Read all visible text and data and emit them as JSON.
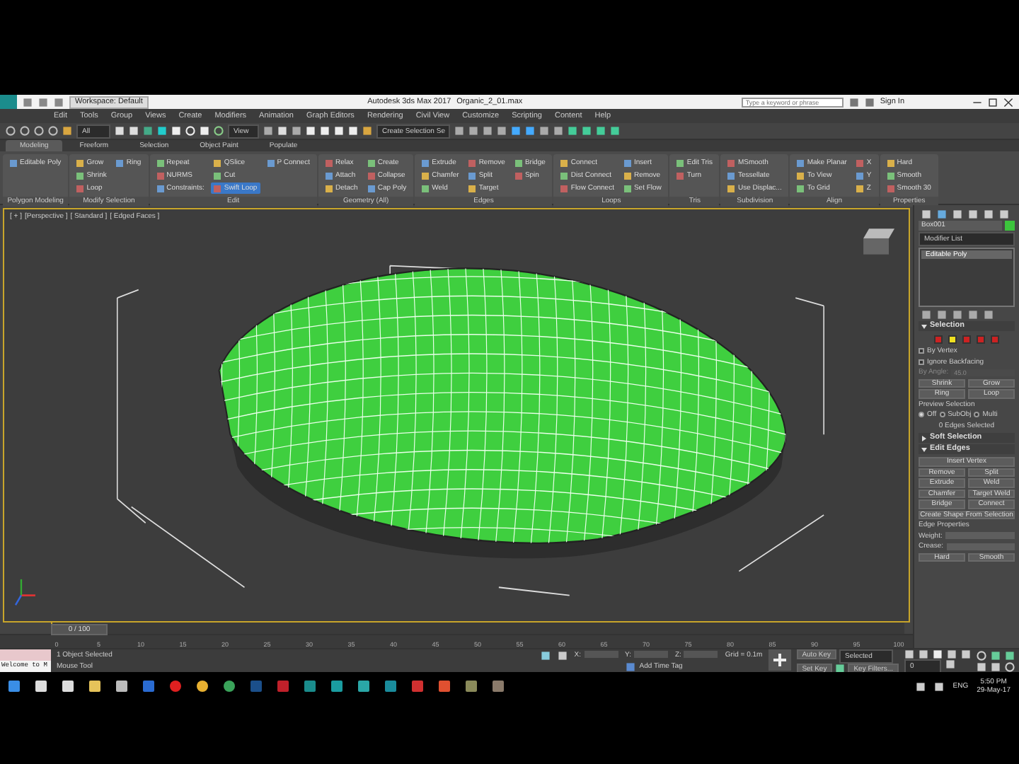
{
  "title_bar": {
    "workspace": "Workspace: Default",
    "title": "Autodesk 3ds Max 2017",
    "file": "Organic_2_01.max",
    "search": {
      "placeholder": "Type a keyword or phrase"
    },
    "sign_in": "Sign In"
  },
  "menu": [
    "Edit",
    "Tools",
    "Group",
    "Views",
    "Create",
    "Modifiers",
    "Animation",
    "Graph Editors",
    "Rendering",
    "Civil View",
    "Customize",
    "Scripting",
    "Content",
    "Help"
  ],
  "toolbar": {
    "filter": "All",
    "ref_coord": "View",
    "selection_set": "Create Selection Se"
  },
  "ribbon_tabs": [
    {
      "label": "Modeling",
      "selected": true
    },
    {
      "label": "Freeform",
      "selected": false
    },
    {
      "label": "Selection",
      "selected": false
    },
    {
      "label": "Object Paint",
      "selected": false
    },
    {
      "label": "Populate",
      "selected": false
    }
  ],
  "ribbon_panels": [
    {
      "title": "Polygon Modeling",
      "items": [
        {
          "label": "Editable Poly",
          "selected": false
        }
      ]
    },
    {
      "title": "Modify Selection",
      "items": [
        {
          "label": "Grow",
          "selected": false
        },
        {
          "label": "Shrink",
          "selected": false
        },
        {
          "label": "Loop",
          "selected": false
        },
        {
          "label": "Ring",
          "selected": false
        }
      ]
    },
    {
      "title": "Edit",
      "items": [
        {
          "label": "Repeat",
          "selected": false
        },
        {
          "label": "NURMS",
          "selected": false
        },
        {
          "label": "Constraints:",
          "selected": false
        },
        {
          "label": "QSlice",
          "selected": false
        },
        {
          "label": "Cut",
          "selected": false
        },
        {
          "label": "Swift Loop",
          "selected": true
        },
        {
          "label": "P Connect",
          "selected": false
        }
      ]
    },
    {
      "title": "Geometry (All)",
      "items": [
        {
          "label": "Relax",
          "selected": false
        },
        {
          "label": "Attach",
          "selected": false
        },
        {
          "label": "Detach",
          "selected": false
        },
        {
          "label": "Create",
          "selected": false
        },
        {
          "label": "Collapse",
          "selected": false
        },
        {
          "label": "Cap Poly",
          "selected": false
        }
      ]
    },
    {
      "title": "Edges",
      "items": [
        {
          "label": "Extrude",
          "selected": false
        },
        {
          "label": "Chamfer",
          "selected": false
        },
        {
          "label": "Weld",
          "selected": false
        },
        {
          "label": "Remove",
          "selected": false
        },
        {
          "label": "Split",
          "selected": false
        },
        {
          "label": "Target",
          "selected": false
        },
        {
          "label": "Bridge",
          "selected": false
        },
        {
          "label": "Spin",
          "selected": false
        }
      ]
    },
    {
      "title": "Loops",
      "items": [
        {
          "label": "Connect",
          "selected": false
        },
        {
          "label": "Dist Connect",
          "selected": false
        },
        {
          "label": "Flow Connect",
          "selected": false
        },
        {
          "label": "Insert",
          "selected": false
        },
        {
          "label": "Remove",
          "selected": false
        },
        {
          "label": "Set Flow",
          "selected": false
        }
      ]
    },
    {
      "title": "Tris",
      "items": [
        {
          "label": "Edit Tris",
          "selected": false
        },
        {
          "label": "Turn",
          "selected": false
        }
      ]
    },
    {
      "title": "Subdivision",
      "items": [
        {
          "label": "MSmooth",
          "selected": false
        },
        {
          "label": "Tessellate",
          "selected": false
        },
        {
          "label": "Use Displac...",
          "selected": false
        }
      ]
    },
    {
      "title": "Align",
      "items": [
        {
          "label": "Make Planar",
          "selected": false
        },
        {
          "label": "To View",
          "selected": false
        },
        {
          "label": "To Grid",
          "selected": false
        },
        {
          "label": "X",
          "selected": false
        },
        {
          "label": "Y",
          "selected": false
        },
        {
          "label": "Z",
          "selected": false
        }
      ]
    },
    {
      "title": "Properties",
      "items": [
        {
          "label": "Hard",
          "selected": false
        },
        {
          "label": "Smooth",
          "selected": false
        },
        {
          "label": "Smooth 30",
          "selected": false
        }
      ]
    }
  ],
  "viewport": {
    "labels": [
      "[ + ]",
      "[Perspective ]",
      "[ Standard ]",
      "[ Edged Faces ]"
    ]
  },
  "command_panel": {
    "object_name": "Box001",
    "modifier_list": "Modifier List",
    "stack": [
      {
        "label": "Editable Poly",
        "selected": true
      }
    ],
    "rollouts": [
      {
        "title": "Selection",
        "expanded": true,
        "subobjects": [
          {
            "selected": false
          },
          {
            "selected": true
          },
          {
            "selected": false
          },
          {
            "selected": false
          },
          {
            "selected": false
          }
        ],
        "rows": [
          {
            "kind": "check",
            "label": "By Vertex",
            "checked": false
          },
          {
            "kind": "check",
            "label": "Ignore Backfacing",
            "checked": false
          },
          {
            "kind": "spinner",
            "label": "By Angle:",
            "value": "45.0",
            "disabled": true
          },
          {
            "kind": "buttons",
            "buttons": [
              "Shrink",
              "Grow"
            ]
          },
          {
            "kind": "buttons",
            "buttons": [
              "Ring",
              "Loop"
            ]
          },
          {
            "kind": "text",
            "label": "Preview Selection"
          },
          {
            "kind": "radio",
            "options": [
              {
                "label": "Off",
                "selected": true
              },
              {
                "label": "SubObj",
                "selected": false
              },
              {
                "label": "Multi",
                "selected": false
              }
            ]
          },
          {
            "kind": "info",
            "label": "0 Edges Selected"
          }
        ]
      },
      {
        "title": "Soft Selection",
        "expanded": false
      },
      {
        "title": "Edit Edges",
        "expanded": true,
        "rows": [
          {
            "kind": "buttons",
            "buttons": [
              "Insert Vertex"
            ]
          },
          {
            "kind": "buttons",
            "buttons": [
              "Remove",
              "Split"
            ]
          },
          {
            "kind": "buttons",
            "buttons": [
              "Extrude",
              "Weld"
            ]
          },
          {
            "kind": "buttons",
            "buttons": [
              "Chamfer",
              "Target Weld"
            ]
          },
          {
            "kind": "buttons",
            "buttons": [
              "Bridge",
              "Connect"
            ]
          },
          {
            "kind": "buttons",
            "buttons": [
              "Create Shape From Selection"
            ]
          },
          {
            "kind": "text",
            "label": "Edge Properties"
          },
          {
            "kind": "spinner",
            "label": "Weight:",
            "disabled": false
          },
          {
            "kind": "spinner",
            "label": "Crease:",
            "disabled": false
          },
          {
            "kind": "buttons",
            "buttons": [
              "Hard",
              "Smooth"
            ]
          }
        ]
      }
    ]
  },
  "time_slider": {
    "label": "0 / 100",
    "level": 0
  },
  "track_ticks": [
    "0",
    "5",
    "10",
    "15",
    "20",
    "25",
    "30",
    "35",
    "40",
    "45",
    "50",
    "55",
    "60",
    "65",
    "70",
    "75",
    "80",
    "85",
    "90",
    "95",
    "100"
  ],
  "status": {
    "listener": "Welcome to M",
    "selection": "1 Object Selected",
    "prompt": "Mouse Tool",
    "x": "X:",
    "y": "Y:",
    "z": "Z:",
    "grid": "Grid = 0.1m",
    "time_tag": "Add Time Tag",
    "auto_key": "Auto Key",
    "key_mode": "Selected",
    "set_key": "Set Key",
    "key_filters": "Key Filters...",
    "frame": "0"
  },
  "tray": {
    "language": "ENG",
    "time": "5:50 PM",
    "date": "29-May-17"
  }
}
